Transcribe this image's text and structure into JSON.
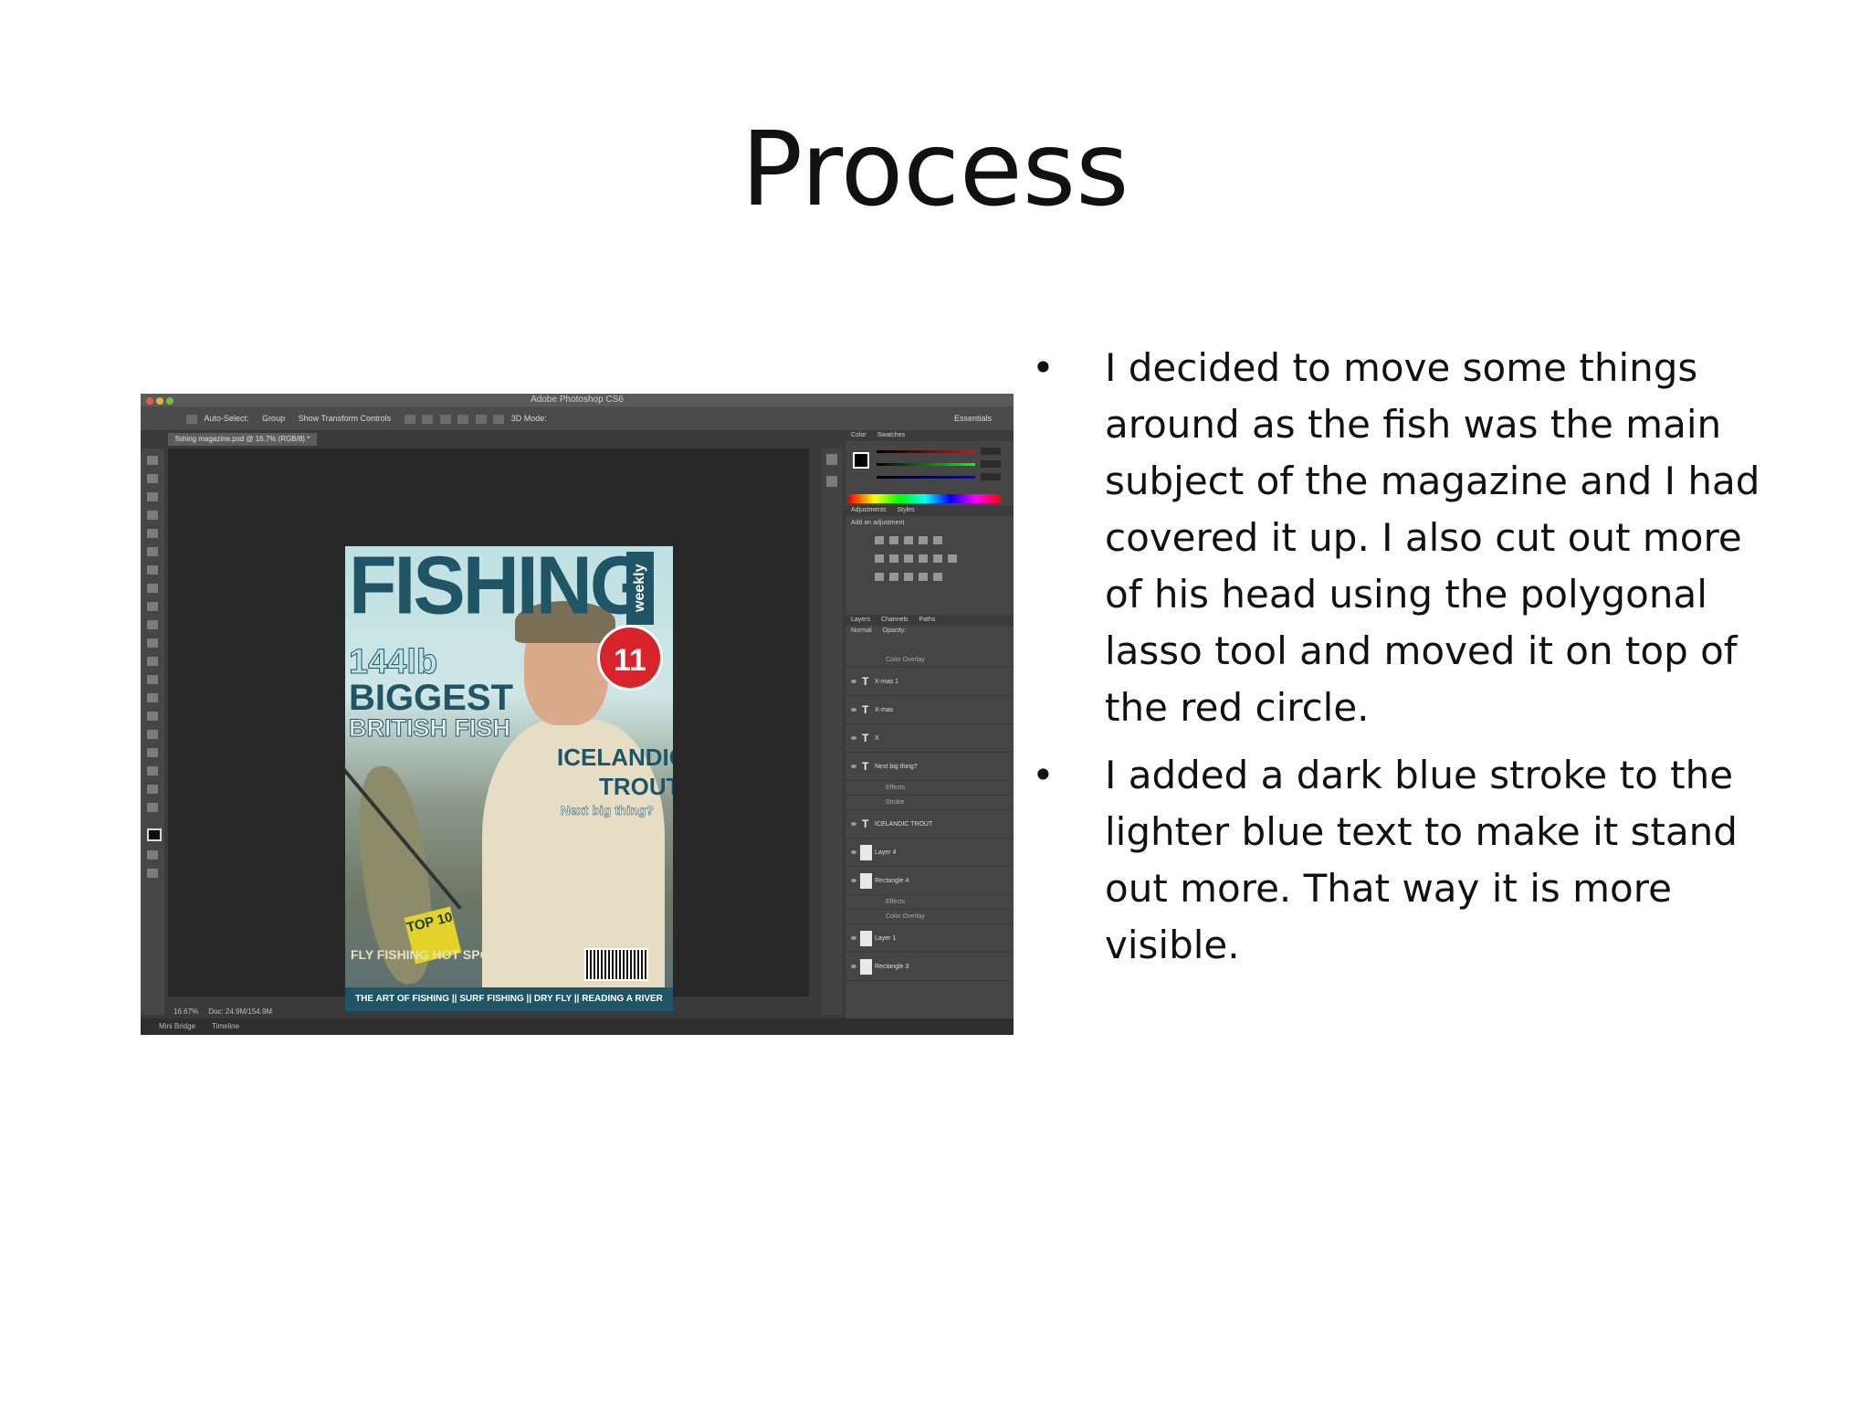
{
  "slide": {
    "title": "Process",
    "bullets": [
      "I decided to move some things around as the fish was the main subject of the magazine and I had covered it up. I also cut out more of his head using the polygonal lasso tool and moved it on top of the red circle.",
      " I added a dark blue stroke to the lighter blue text to make it stand out more. That way it is more visible."
    ],
    "bullet_glyph": "•"
  },
  "screenshot": {
    "app_title": "Adobe Photoshop CS6",
    "document_tab": "fishing magazine.psd @ 16.7% (RGB/8) *",
    "options": [
      "Auto-Select:",
      "Group",
      "Show Transform Controls",
      "3D Mode:",
      "Essentials"
    ],
    "status_zoom": "16.67%",
    "status_doc": "Doc: 24.9M/154.9M",
    "bottom_tabs": [
      "Mini Bridge",
      "Timeline"
    ],
    "panels": {
      "color_tabs": [
        "Color",
        "Swatches"
      ],
      "adjust_tabs": [
        "Adjustments",
        "Styles"
      ],
      "adjust_title": "Add an adjustment",
      "layers_tabs": [
        "Layers",
        "Channels",
        "Paths"
      ],
      "layer_filter": "Normal",
      "layer_opacity": "Opacity:",
      "layers": [
        {
          "kind": "sub",
          "name": "Color Overlay"
        },
        {
          "kind": "text",
          "name": "X-mas 1"
        },
        {
          "kind": "text",
          "name": "X-mas"
        },
        {
          "kind": "text",
          "name": "X"
        },
        {
          "kind": "text",
          "name": "Next big thing?"
        },
        {
          "kind": "sub",
          "name": "Effects"
        },
        {
          "kind": "sub",
          "name": "Stroke"
        },
        {
          "kind": "text",
          "name": "ICELANDIC    TROUT"
        },
        {
          "kind": "image",
          "name": "Layer 4"
        },
        {
          "kind": "image",
          "name": "Rectangle 4"
        },
        {
          "kind": "sub",
          "name": "Effects"
        },
        {
          "kind": "sub",
          "name": "Color Overlay"
        },
        {
          "kind": "image",
          "name": "Layer 1"
        },
        {
          "kind": "image",
          "name": "Rectangle 3"
        }
      ]
    },
    "colors": {
      "cover_blue": "#1f5564",
      "badge_red": "#d8232a"
    }
  },
  "cover": {
    "masthead": "FISHING",
    "weekly": "weekly",
    "badge": "11",
    "line_144": "144lb",
    "line_biggest": "BIGGEST",
    "line_british": "BRITISH FISH",
    "line_icelandic": "ICELANDIC",
    "line_trout": "TROUT",
    "line_nextbig": "Next big thing?",
    "top10": "TOP 10",
    "flyfishing": "FLY FISHING HOT SPOTS",
    "strip": "THE ART OF FISHING || SURF FISHING || DRY FLY || READING A RIVER"
  }
}
